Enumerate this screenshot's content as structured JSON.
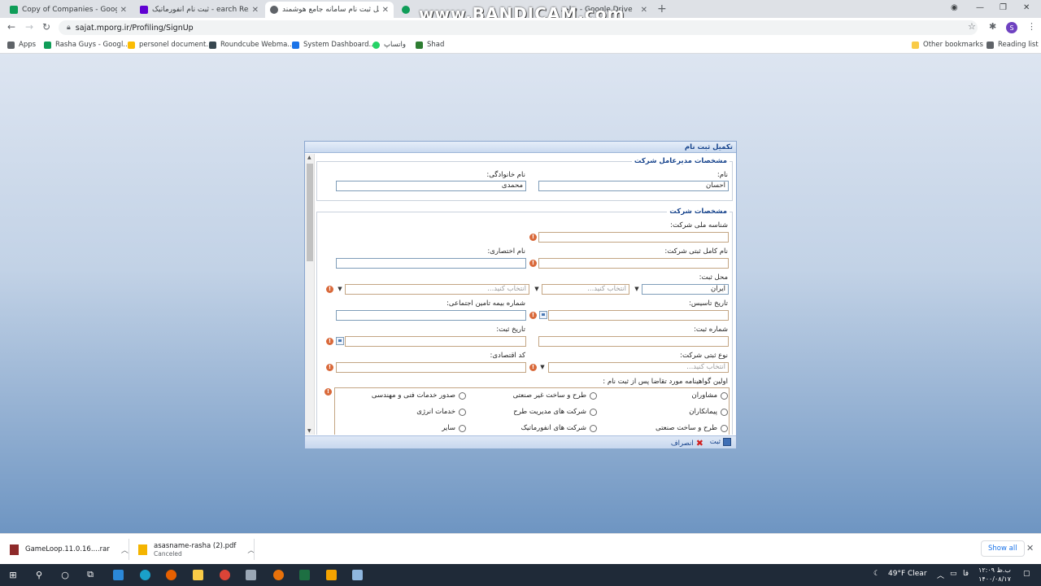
{
  "browser": {
    "tabs": [
      {
        "title": "Copy of Companies - Google She",
        "color": "#0f9d58",
        "active": false
      },
      {
        "title": "ثبت نام انفورماتیک - earch Results",
        "color": "#6001d2",
        "active": false
      },
      {
        "title": "تکمیل ثبت نام سامانه جامع هوشمند",
        "color": "#5f6368",
        "active": true
      },
      {
        "title": "ساجد - Google Drive",
        "color": "#0f9d58",
        "active": false
      }
    ],
    "watermark": "www.BANDICAM.com",
    "url": "sajat.mporg.ir/Profiling/SignUp",
    "bookmarks": [
      {
        "label": "Apps",
        "color": "#5f6368"
      },
      {
        "label": "Rasha Guys - Googl...",
        "color": "#0f9d58"
      },
      {
        "label": "personel document...",
        "color": "#fbbc04"
      },
      {
        "label": "Roundcube Webma...",
        "color": "#37474f"
      },
      {
        "label": "System Dashboard...",
        "color": "#1a73e8"
      },
      {
        "label": "واتساپ",
        "color": "#25d366"
      },
      {
        "label": "Shad",
        "color": "#2e7d32"
      }
    ],
    "other_bookmarks": "Other bookmarks",
    "reading_list": "Reading list",
    "avatar_letter": "S"
  },
  "dialog": {
    "title": "تکمیل ثبت نام",
    "manager_section": {
      "legend": "مشخصات مدیرعامل شرکت",
      "first_name_label": "نام:",
      "first_name_value": "احسان",
      "last_name_label": "نام خانوادگی:",
      "last_name_value": "محمدی"
    },
    "company_section": {
      "legend": "مشخصات شرکت",
      "national_id_label": "شناسه ملی شرکت:",
      "full_name_label": "نام کامل ثبتی شرکت:",
      "short_name_label": "نام اختصاری:",
      "reg_place_label": "محل ثبت:",
      "country_value": "ایران",
      "select_placeholder": "انتخاب کنید...",
      "founding_date_label": "تاریخ تاسیس:",
      "insurance_label": "شماره بیمه تامین اجتماعی:",
      "reg_number_label": "شماره ثبت:",
      "reg_date_label": "تاریخ ثبت:",
      "company_type_label": "نوع ثبتی شرکت:",
      "economic_code_label": "کد اقتصادی:",
      "certificate_label": "اولین گواهینامه مورد تقاضا پس از ثبت نام :",
      "certificate_options": [
        "مشاوران",
        "طرح و ساخت غیر صنعتی",
        "صدور خدمات فنی و مهندسی",
        "پیمانکاران",
        "شرکت های مدیریت طرح",
        "خدمات انرژی",
        "طرح و ساخت صنعتی",
        "شرکت های انفورماتیک",
        "سایر"
      ]
    },
    "footer": {
      "save_label": "ثبت",
      "cancel_label": "انصراف"
    }
  },
  "downloads": [
    {
      "name": "GameLoop.11.0.16....rar",
      "status": "",
      "color": "#8e2a2a"
    },
    {
      "name": "asasname-rasha (2).pdf",
      "status": "Canceled",
      "color": "#f4b400"
    }
  ],
  "show_all": "Show all",
  "taskbar": {
    "weather": "49°F  Clear",
    "lang": "فا",
    "time": "۱۲:۰۹ ب.ظ",
    "date": "۱۴۰۰/۰۸/۱۷"
  }
}
